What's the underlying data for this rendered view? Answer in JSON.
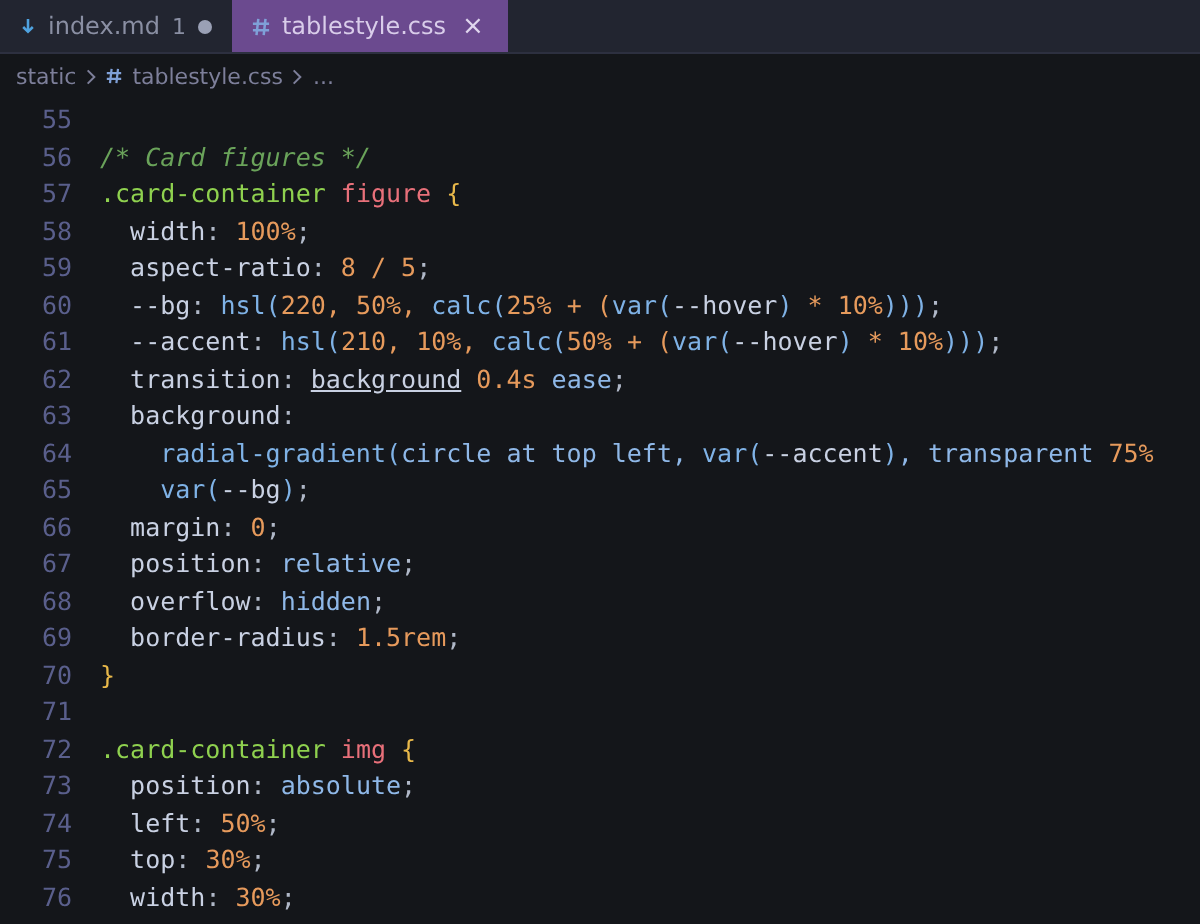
{
  "tabs": [
    {
      "label": "index.md",
      "badge": "1",
      "kind": "markdown",
      "modified": true,
      "selected": false
    },
    {
      "label": "tablestyle.css",
      "kind": "css",
      "close": "×",
      "modified": false,
      "selected": true
    }
  ],
  "breadcrumb": [
    {
      "kind": "folder",
      "text": "static"
    },
    {
      "kind": "file",
      "text": "tablestyle.css"
    },
    {
      "kind": "more",
      "text": "..."
    }
  ],
  "lines": [
    {
      "number": "55"
    },
    {
      "number": "56",
      "tokens": [
        {
          "kind": "comment",
          "text": "/* Card figures */"
        }
      ]
    },
    {
      "number": "57",
      "tokens": [
        {
          "kind": "selector",
          "text": ".card-container"
        },
        {
          "kind": "tag",
          "text": " figure"
        },
        {
          "kind": "brace",
          "text": " {"
        }
      ]
    },
    {
      "number": "58",
      "tokens": [
        {
          "kind": "prop",
          "text": "  width"
        },
        {
          "kind": "punct",
          "text": ": "
        },
        {
          "kind": "num",
          "text": "100%"
        },
        {
          "kind": "punct",
          "text": ";"
        }
      ]
    },
    {
      "number": "59",
      "tokens": [
        {
          "kind": "prop",
          "text": "  aspect-ratio"
        },
        {
          "kind": "punct",
          "text": ": "
        },
        {
          "kind": "num",
          "text": "8 / 5"
        },
        {
          "kind": "punct",
          "text": ";"
        }
      ]
    },
    {
      "number": "60",
      "tokens": [
        {
          "kind": "prop",
          "text": "  --bg"
        },
        {
          "kind": "punct",
          "text": ": "
        },
        {
          "kind": "func",
          "text": "hsl("
        },
        {
          "kind": "num",
          "text": "220, 50%, "
        },
        {
          "kind": "func",
          "text": "calc("
        },
        {
          "kind": "num",
          "text": "25% + ("
        },
        {
          "kind": "func",
          "text": "var("
        },
        {
          "kind": "prop",
          "text": "--hover"
        },
        {
          "kind": "func",
          "text": ")"
        },
        {
          "kind": "num",
          "text": " * 10%"
        },
        {
          "kind": "func",
          "text": ")))"
        },
        {
          "kind": "punct",
          "text": ";"
        }
      ]
    },
    {
      "number": "61",
      "tokens": [
        {
          "kind": "prop",
          "text": "  --accent"
        },
        {
          "kind": "punct",
          "text": ": "
        },
        {
          "kind": "func",
          "text": "hsl("
        },
        {
          "kind": "num",
          "text": "210, 10%, "
        },
        {
          "kind": "func",
          "text": "calc("
        },
        {
          "kind": "num",
          "text": "50% + ("
        },
        {
          "kind": "func",
          "text": "var("
        },
        {
          "kind": "prop",
          "text": "--hover"
        },
        {
          "kind": "func",
          "text": ")"
        },
        {
          "kind": "num",
          "text": " * 10%"
        },
        {
          "kind": "func",
          "text": ")))"
        },
        {
          "kind": "punct",
          "text": ";"
        }
      ]
    },
    {
      "number": "62",
      "tokens": [
        {
          "kind": "prop",
          "text": "  transition"
        },
        {
          "kind": "punct",
          "text": ": "
        },
        {
          "kind": "underlined",
          "text": "background"
        },
        {
          "kind": "num",
          "text": " 0.4s"
        },
        {
          "kind": "value",
          "text": " ease"
        },
        {
          "kind": "punct",
          "text": ";"
        }
      ]
    },
    {
      "number": "63",
      "tokens": [
        {
          "kind": "prop",
          "text": "  background"
        },
        {
          "kind": "punct",
          "text": ":"
        }
      ]
    },
    {
      "number": "64",
      "tokens": [
        {
          "kind": "func",
          "text": "    radial-gradient("
        },
        {
          "kind": "value",
          "text": "circle at top left, "
        },
        {
          "kind": "func",
          "text": "var("
        },
        {
          "kind": "prop",
          "text": "--accent"
        },
        {
          "kind": "func",
          "text": ")"
        },
        {
          "kind": "value",
          "text": ", transparent "
        },
        {
          "kind": "num",
          "text": "75%"
        }
      ]
    },
    {
      "number": "65",
      "tokens": [
        {
          "kind": "func",
          "text": "    var("
        },
        {
          "kind": "prop",
          "text": "--bg"
        },
        {
          "kind": "func",
          "text": ")"
        },
        {
          "kind": "punct",
          "text": ";"
        }
      ]
    },
    {
      "number": "66",
      "tokens": [
        {
          "kind": "prop",
          "text": "  margin"
        },
        {
          "kind": "punct",
          "text": ": "
        },
        {
          "kind": "num",
          "text": "0"
        },
        {
          "kind": "punct",
          "text": ";"
        }
      ]
    },
    {
      "number": "67",
      "tokens": [
        {
          "kind": "prop",
          "text": "  position"
        },
        {
          "kind": "punct",
          "text": ": "
        },
        {
          "kind": "value",
          "text": "relative"
        },
        {
          "kind": "punct",
          "text": ";"
        }
      ]
    },
    {
      "number": "68",
      "tokens": [
        {
          "kind": "prop",
          "text": "  overflow"
        },
        {
          "kind": "punct",
          "text": ": "
        },
        {
          "kind": "value",
          "text": "hidden"
        },
        {
          "kind": "punct",
          "text": ";"
        }
      ]
    },
    {
      "number": "69",
      "tokens": [
        {
          "kind": "prop",
          "text": "  border-radius"
        },
        {
          "kind": "punct",
          "text": ": "
        },
        {
          "kind": "num",
          "text": "1.5rem"
        },
        {
          "kind": "punct",
          "text": ";"
        }
      ]
    },
    {
      "number": "70",
      "tokens": [
        {
          "kind": "brace",
          "text": "}"
        }
      ]
    },
    {
      "number": "71"
    },
    {
      "number": "72",
      "tokens": [
        {
          "kind": "selector",
          "text": ".card-container"
        },
        {
          "kind": "tag",
          "text": " img"
        },
        {
          "kind": "brace",
          "text": " {"
        }
      ]
    },
    {
      "number": "73",
      "tokens": [
        {
          "kind": "prop",
          "text": "  position"
        },
        {
          "kind": "punct",
          "text": ": "
        },
        {
          "kind": "value",
          "text": "absolute"
        },
        {
          "kind": "punct",
          "text": ";"
        }
      ]
    },
    {
      "number": "74",
      "tokens": [
        {
          "kind": "prop",
          "text": "  left"
        },
        {
          "kind": "punct",
          "text": ": "
        },
        {
          "kind": "num",
          "text": "50%"
        },
        {
          "kind": "punct",
          "text": ";"
        }
      ]
    },
    {
      "number": "75",
      "tokens": [
        {
          "kind": "prop",
          "text": "  top"
        },
        {
          "kind": "punct",
          "text": ": "
        },
        {
          "kind": "num",
          "text": "30%"
        },
        {
          "kind": "punct",
          "text": ";"
        }
      ]
    },
    {
      "number": "76",
      "tokens": [
        {
          "kind": "prop",
          "text": "  width"
        },
        {
          "kind": "punct",
          "text": ": "
        },
        {
          "kind": "num",
          "text": "30%"
        },
        {
          "kind": "punct",
          "text": ";"
        }
      ]
    }
  ]
}
